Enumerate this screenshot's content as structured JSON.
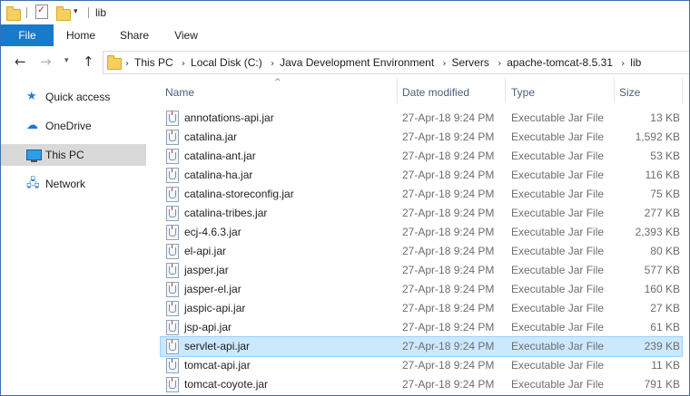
{
  "window": {
    "title": "lib"
  },
  "ribbon": {
    "tabs": [
      "File",
      "Home",
      "Share",
      "View"
    ]
  },
  "address": {
    "crumbs": [
      "This PC",
      "Local Disk (C:)",
      "Java Development Environment",
      "Servers",
      "apache-tomcat-8.5.31",
      "lib"
    ]
  },
  "sidebar": {
    "items": [
      {
        "label": "Quick access",
        "icon": "star-icon"
      },
      {
        "label": "OneDrive",
        "icon": "cloud-icon"
      },
      {
        "label": "This PC",
        "icon": "computer-icon",
        "selected": true
      },
      {
        "label": "Network",
        "icon": "network-icon"
      }
    ]
  },
  "columns": {
    "name": "Name",
    "date": "Date modified",
    "type": "Type",
    "size": "Size"
  },
  "files": [
    {
      "name": "annotations-api.jar",
      "date": "27-Apr-18 9:24 PM",
      "type": "Executable Jar File",
      "size": "13 KB"
    },
    {
      "name": "catalina.jar",
      "date": "27-Apr-18 9:24 PM",
      "type": "Executable Jar File",
      "size": "1,592 KB"
    },
    {
      "name": "catalina-ant.jar",
      "date": "27-Apr-18 9:24 PM",
      "type": "Executable Jar File",
      "size": "53 KB"
    },
    {
      "name": "catalina-ha.jar",
      "date": "27-Apr-18 9:24 PM",
      "type": "Executable Jar File",
      "size": "116 KB"
    },
    {
      "name": "catalina-storeconfig.jar",
      "date": "27-Apr-18 9:24 PM",
      "type": "Executable Jar File",
      "size": "75 KB"
    },
    {
      "name": "catalina-tribes.jar",
      "date": "27-Apr-18 9:24 PM",
      "type": "Executable Jar File",
      "size": "277 KB"
    },
    {
      "name": "ecj-4.6.3.jar",
      "date": "27-Apr-18 9:24 PM",
      "type": "Executable Jar File",
      "size": "2,393 KB"
    },
    {
      "name": "el-api.jar",
      "date": "27-Apr-18 9:24 PM",
      "type": "Executable Jar File",
      "size": "80 KB"
    },
    {
      "name": "jasper.jar",
      "date": "27-Apr-18 9:24 PM",
      "type": "Executable Jar File",
      "size": "577 KB"
    },
    {
      "name": "jasper-el.jar",
      "date": "27-Apr-18 9:24 PM",
      "type": "Executable Jar File",
      "size": "160 KB"
    },
    {
      "name": "jaspic-api.jar",
      "date": "27-Apr-18 9:24 PM",
      "type": "Executable Jar File",
      "size": "27 KB"
    },
    {
      "name": "jsp-api.jar",
      "date": "27-Apr-18 9:24 PM",
      "type": "Executable Jar File",
      "size": "61 KB"
    },
    {
      "name": "servlet-api.jar",
      "date": "27-Apr-18 9:24 PM",
      "type": "Executable Jar File",
      "size": "239 KB",
      "selected": true
    },
    {
      "name": "tomcat-api.jar",
      "date": "27-Apr-18 9:24 PM",
      "type": "Executable Jar File",
      "size": "11 KB"
    },
    {
      "name": "tomcat-coyote.jar",
      "date": "27-Apr-18 9:24 PM",
      "type": "Executable Jar File",
      "size": "791 KB"
    }
  ]
}
